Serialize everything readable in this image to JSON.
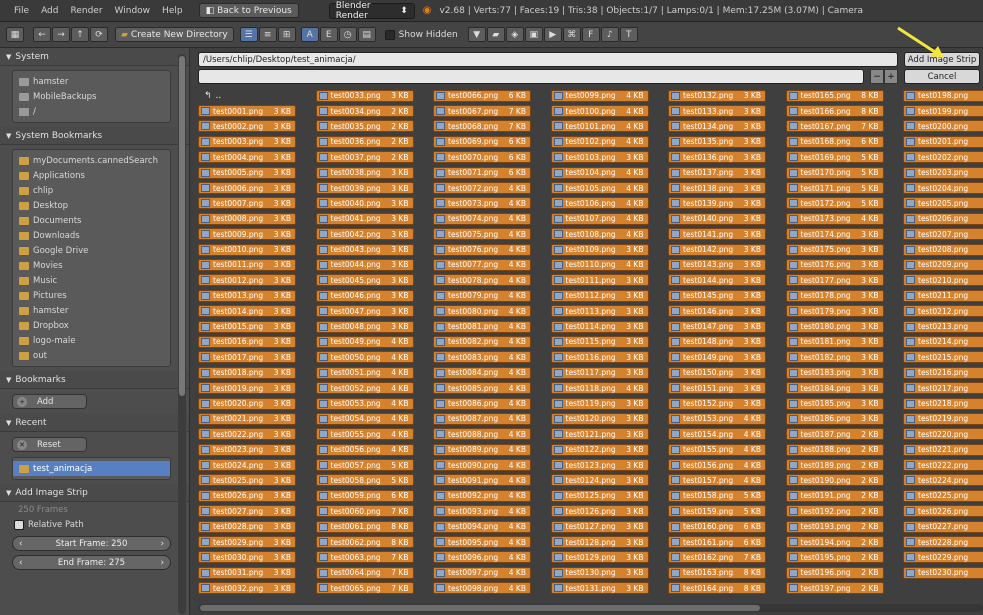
{
  "topbar": {
    "menu": [
      "File",
      "Add",
      "Render",
      "Window",
      "Help"
    ],
    "back_label": "Back to Previous",
    "engine": "Blender Render",
    "info": "v2.68 | Verts:77 | Faces:19 | Tris:38 | Objects:1/7 | Lamps:0/1 | Mem:17.25M (3.07M) | Camera"
  },
  "toolbar": {
    "create_dir_label": "Create New Directory",
    "show_hidden_label": "Show Hidden"
  },
  "sidebar": {
    "system_header": "System",
    "system_items": [
      "hamster",
      "MobileBackups",
      "/"
    ],
    "bookmarks_sys_header": "System Bookmarks",
    "bookmark_items": [
      "myDocuments.cannedSearch",
      "Applications",
      "chlip",
      "Desktop",
      "Documents",
      "Downloads",
      "Google Drive",
      "Movies",
      "Music",
      "Pictures",
      "hamster",
      "Dropbox",
      "logo-male",
      "out"
    ],
    "bookmarks_header": "Bookmarks",
    "add_label": "Add",
    "recent_header": "Recent",
    "reset_label": "Reset",
    "recent_items": [
      "test_animacja"
    ],
    "strip_header": "Add Image Strip",
    "frames_label": "250 Frames",
    "relative_label": "Relative Path",
    "start_frame": "Start Frame: 250",
    "end_frame": "End Frame: 275"
  },
  "main": {
    "path": "/Users/chlip/Desktop/test_animacja/",
    "filename": "",
    "add_strip_label": "Add Image Strip",
    "cancel_label": "Cancel",
    "parent_label": "..",
    "columns": [
      {
        "files": [
          [
            "test0001.png",
            "3 KB"
          ],
          [
            "test0002.png",
            "3 KB"
          ],
          [
            "test0003.png",
            "3 KB"
          ],
          [
            "test0004.png",
            "3 KB"
          ],
          [
            "test0005.png",
            "3 KB"
          ],
          [
            "test0006.png",
            "3 KB"
          ],
          [
            "test0007.png",
            "3 KB"
          ],
          [
            "test0008.png",
            "3 KB"
          ],
          [
            "test0009.png",
            "3 KB"
          ],
          [
            "test0010.png",
            "3 KB"
          ],
          [
            "test0011.png",
            "3 KB"
          ],
          [
            "test0012.png",
            "3 KB"
          ],
          [
            "test0013.png",
            "3 KB"
          ],
          [
            "test0014.png",
            "3 KB"
          ],
          [
            "test0015.png",
            "3 KB"
          ],
          [
            "test0016.png",
            "3 KB"
          ],
          [
            "test0017.png",
            "3 KB"
          ],
          [
            "test0018.png",
            "3 KB"
          ],
          [
            "test0019.png",
            "3 KB"
          ],
          [
            "test0020.png",
            "3 KB"
          ],
          [
            "test0021.png",
            "3 KB"
          ],
          [
            "test0022.png",
            "3 KB"
          ],
          [
            "test0023.png",
            "3 KB"
          ],
          [
            "test0024.png",
            "3 KB"
          ],
          [
            "test0025.png",
            "3 KB"
          ],
          [
            "test0026.png",
            "3 KB"
          ],
          [
            "test0027.png",
            "3 KB"
          ],
          [
            "test0028.png",
            "3 KB"
          ],
          [
            "test0029.png",
            "3 KB"
          ],
          [
            "test0030.png",
            "3 KB"
          ],
          [
            "test0031.png",
            "3 KB"
          ],
          [
            "test0032.png",
            "3 KB"
          ]
        ]
      },
      {
        "files": [
          [
            "test0033.png",
            "3 KB"
          ],
          [
            "test0034.png",
            "2 KB"
          ],
          [
            "test0035.png",
            "2 KB"
          ],
          [
            "test0036.png",
            "2 KB"
          ],
          [
            "test0037.png",
            "2 KB"
          ],
          [
            "test0038.png",
            "3 KB"
          ],
          [
            "test0039.png",
            "3 KB"
          ],
          [
            "test0040.png",
            "3 KB"
          ],
          [
            "test0041.png",
            "3 KB"
          ],
          [
            "test0042.png",
            "3 KB"
          ],
          [
            "test0043.png",
            "3 KB"
          ],
          [
            "test0044.png",
            "3 KB"
          ],
          [
            "test0045.png",
            "3 KB"
          ],
          [
            "test0046.png",
            "3 KB"
          ],
          [
            "test0047.png",
            "3 KB"
          ],
          [
            "test0048.png",
            "3 KB"
          ],
          [
            "test0049.png",
            "4 KB"
          ],
          [
            "test0050.png",
            "4 KB"
          ],
          [
            "test0051.png",
            "4 KB"
          ],
          [
            "test0052.png",
            "4 KB"
          ],
          [
            "test0053.png",
            "4 KB"
          ],
          [
            "test0054.png",
            "4 KB"
          ],
          [
            "test0055.png",
            "4 KB"
          ],
          [
            "test0056.png",
            "4 KB"
          ],
          [
            "test0057.png",
            "5 KB"
          ],
          [
            "test0058.png",
            "5 KB"
          ],
          [
            "test0059.png",
            "6 KB"
          ],
          [
            "test0060.png",
            "7 KB"
          ],
          [
            "test0061.png",
            "8 KB"
          ],
          [
            "test0062.png",
            "8 KB"
          ],
          [
            "test0063.png",
            "7 KB"
          ],
          [
            "test0064.png",
            "7 KB"
          ],
          [
            "test0065.png",
            "7 KB"
          ]
        ]
      },
      {
        "files": [
          [
            "test0066.png",
            "6 KB"
          ],
          [
            "test0067.png",
            "7 KB"
          ],
          [
            "test0068.png",
            "7 KB"
          ],
          [
            "test0069.png",
            "6 KB"
          ],
          [
            "test0070.png",
            "6 KB"
          ],
          [
            "test0071.png",
            "6 KB"
          ],
          [
            "test0072.png",
            "4 KB"
          ],
          [
            "test0073.png",
            "4 KB"
          ],
          [
            "test0074.png",
            "4 KB"
          ],
          [
            "test0075.png",
            "4 KB"
          ],
          [
            "test0076.png",
            "4 KB"
          ],
          [
            "test0077.png",
            "4 KB"
          ],
          [
            "test0078.png",
            "4 KB"
          ],
          [
            "test0079.png",
            "4 KB"
          ],
          [
            "test0080.png",
            "4 KB"
          ],
          [
            "test0081.png",
            "4 KB"
          ],
          [
            "test0082.png",
            "4 KB"
          ],
          [
            "test0083.png",
            "4 KB"
          ],
          [
            "test0084.png",
            "4 KB"
          ],
          [
            "test0085.png",
            "4 KB"
          ],
          [
            "test0086.png",
            "4 KB"
          ],
          [
            "test0087.png",
            "4 KB"
          ],
          [
            "test0088.png",
            "4 KB"
          ],
          [
            "test0089.png",
            "4 KB"
          ],
          [
            "test0090.png",
            "4 KB"
          ],
          [
            "test0091.png",
            "4 KB"
          ],
          [
            "test0092.png",
            "4 KB"
          ],
          [
            "test0093.png",
            "4 KB"
          ],
          [
            "test0094.png",
            "4 KB"
          ],
          [
            "test0095.png",
            "4 KB"
          ],
          [
            "test0096.png",
            "4 KB"
          ],
          [
            "test0097.png",
            "4 KB"
          ],
          [
            "test0098.png",
            "4 KB"
          ]
        ]
      },
      {
        "files": [
          [
            "test0099.png",
            "4 KB"
          ],
          [
            "test0100.png",
            "4 KB"
          ],
          [
            "test0101.png",
            "4 KB"
          ],
          [
            "test0102.png",
            "4 KB"
          ],
          [
            "test0103.png",
            "3 KB"
          ],
          [
            "test0104.png",
            "4 KB"
          ],
          [
            "test0105.png",
            "4 KB"
          ],
          [
            "test0106.png",
            "4 KB"
          ],
          [
            "test0107.png",
            "4 KB"
          ],
          [
            "test0108.png",
            "4 KB"
          ],
          [
            "test0109.png",
            "3 KB"
          ],
          [
            "test0110.png",
            "4 KB"
          ],
          [
            "test0111.png",
            "3 KB"
          ],
          [
            "test0112.png",
            "3 KB"
          ],
          [
            "test0113.png",
            "3 KB"
          ],
          [
            "test0114.png",
            "3 KB"
          ],
          [
            "test0115.png",
            "3 KB"
          ],
          [
            "test0116.png",
            "3 KB"
          ],
          [
            "test0117.png",
            "3 KB"
          ],
          [
            "test0118.png",
            "4 KB"
          ],
          [
            "test0119.png",
            "3 KB"
          ],
          [
            "test0120.png",
            "3 KB"
          ],
          [
            "test0121.png",
            "3 KB"
          ],
          [
            "test0122.png",
            "3 KB"
          ],
          [
            "test0123.png",
            "3 KB"
          ],
          [
            "test0124.png",
            "3 KB"
          ],
          [
            "test0125.png",
            "3 KB"
          ],
          [
            "test0126.png",
            "3 KB"
          ],
          [
            "test0127.png",
            "3 KB"
          ],
          [
            "test0128.png",
            "3 KB"
          ],
          [
            "test0129.png",
            "3 KB"
          ],
          [
            "test0130.png",
            "3 KB"
          ],
          [
            "test0131.png",
            "3 KB"
          ]
        ]
      },
      {
        "files": [
          [
            "test0132.png",
            "3 KB"
          ],
          [
            "test0133.png",
            "3 KB"
          ],
          [
            "test0134.png",
            "3 KB"
          ],
          [
            "test0135.png",
            "3 KB"
          ],
          [
            "test0136.png",
            "3 KB"
          ],
          [
            "test0137.png",
            "3 KB"
          ],
          [
            "test0138.png",
            "3 KB"
          ],
          [
            "test0139.png",
            "3 KB"
          ],
          [
            "test0140.png",
            "3 KB"
          ],
          [
            "test0141.png",
            "3 KB"
          ],
          [
            "test0142.png",
            "3 KB"
          ],
          [
            "test0143.png",
            "3 KB"
          ],
          [
            "test0144.png",
            "3 KB"
          ],
          [
            "test0145.png",
            "3 KB"
          ],
          [
            "test0146.png",
            "3 KB"
          ],
          [
            "test0147.png",
            "3 KB"
          ],
          [
            "test0148.png",
            "3 KB"
          ],
          [
            "test0149.png",
            "3 KB"
          ],
          [
            "test0150.png",
            "3 KB"
          ],
          [
            "test0151.png",
            "3 KB"
          ],
          [
            "test0152.png",
            "3 KB"
          ],
          [
            "test0153.png",
            "4 KB"
          ],
          [
            "test0154.png",
            "4 KB"
          ],
          [
            "test0155.png",
            "4 KB"
          ],
          [
            "test0156.png",
            "4 KB"
          ],
          [
            "test0157.png",
            "4 KB"
          ],
          [
            "test0158.png",
            "5 KB"
          ],
          [
            "test0159.png",
            "5 KB"
          ],
          [
            "test0160.png",
            "6 KB"
          ],
          [
            "test0161.png",
            "6 KB"
          ],
          [
            "test0162.png",
            "7 KB"
          ],
          [
            "test0163.png",
            "8 KB"
          ],
          [
            "test0164.png",
            "8 KB"
          ]
        ]
      },
      {
        "files": [
          [
            "test0165.png",
            "8 KB"
          ],
          [
            "test0166.png",
            "8 KB"
          ],
          [
            "test0167.png",
            "7 KB"
          ],
          [
            "test0168.png",
            "6 KB"
          ],
          [
            "test0169.png",
            "5 KB"
          ],
          [
            "test0170.png",
            "5 KB"
          ],
          [
            "test0171.png",
            "5 KB"
          ],
          [
            "test0172.png",
            "5 KB"
          ],
          [
            "test0173.png",
            "4 KB"
          ],
          [
            "test0174.png",
            "3 KB"
          ],
          [
            "test0175.png",
            "3 KB"
          ],
          [
            "test0176.png",
            "3 KB"
          ],
          [
            "test0177.png",
            "3 KB"
          ],
          [
            "test0178.png",
            "3 KB"
          ],
          [
            "test0179.png",
            "3 KB"
          ],
          [
            "test0180.png",
            "3 KB"
          ],
          [
            "test0181.png",
            "3 KB"
          ],
          [
            "test0182.png",
            "3 KB"
          ],
          [
            "test0183.png",
            "3 KB"
          ],
          [
            "test0184.png",
            "3 KB"
          ],
          [
            "test0185.png",
            "3 KB"
          ],
          [
            "test0186.png",
            "3 KB"
          ],
          [
            "test0187.png",
            "2 KB"
          ],
          [
            "test0188.png",
            "2 KB"
          ],
          [
            "test0189.png",
            "2 KB"
          ],
          [
            "test0190.png",
            "2 KB"
          ],
          [
            "test0191.png",
            "2 KB"
          ],
          [
            "test0192.png",
            "2 KB"
          ],
          [
            "test0193.png",
            "2 KB"
          ],
          [
            "test0194.png",
            "2 KB"
          ],
          [
            "test0195.png",
            "2 KB"
          ],
          [
            "test0196.png",
            "2 KB"
          ],
          [
            "test0197.png",
            "2 KB"
          ]
        ]
      },
      {
        "files": [
          [
            "test0198.png",
            "1"
          ],
          [
            "test0199.png",
            "1"
          ],
          [
            "test0200.png",
            "1"
          ],
          [
            "test0201.png",
            "1"
          ],
          [
            "test0202.png",
            "1"
          ],
          [
            "test0203.png",
            "1"
          ],
          [
            "test0204.png",
            "1"
          ],
          [
            "test0205.png",
            "1"
          ],
          [
            "test0206.png",
            "1"
          ],
          [
            "test0207.png",
            "1"
          ],
          [
            "test0208.png",
            "2"
          ],
          [
            "test0209.png",
            "1"
          ],
          [
            "test0210.png",
            "1"
          ],
          [
            "test0211.png",
            "1"
          ],
          [
            "test0212.png",
            "1"
          ],
          [
            "test0213.png",
            "1"
          ],
          [
            "test0214.png",
            "1"
          ],
          [
            "test0215.png",
            "1"
          ],
          [
            "test0216.png",
            "1"
          ],
          [
            "test0217.png",
            "1"
          ],
          [
            "test0218.png",
            "1"
          ],
          [
            "test0219.png",
            "1"
          ],
          [
            "test0220.png",
            "1"
          ],
          [
            "test0221.png",
            "1"
          ],
          [
            "test0222.png",
            "1"
          ],
          [
            "test0224.png",
            "1"
          ],
          [
            "test0225.png",
            "1"
          ],
          [
            "test0226.png",
            "1"
          ],
          [
            "test0227.png",
            "1"
          ],
          [
            "test0228.png",
            "1"
          ],
          [
            "test0229.png",
            "1"
          ],
          [
            "test0230.png",
            "1"
          ]
        ]
      }
    ]
  },
  "colors": {
    "file_pill": "#d5822f",
    "selected": "#5680c2",
    "arrow": "#f2e63a"
  }
}
